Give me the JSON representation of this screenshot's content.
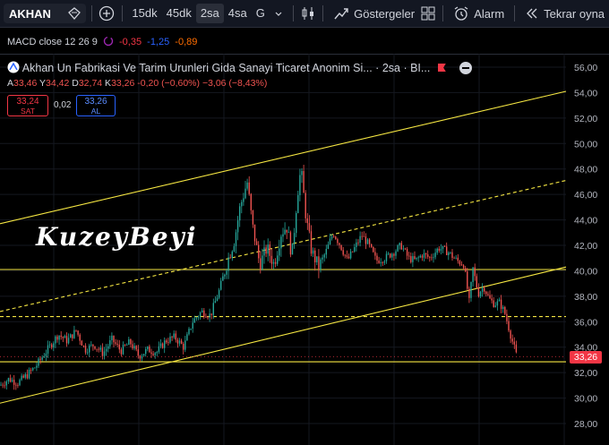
{
  "toolbar": {
    "symbol": "AKHAN",
    "intervals": [
      "15dk",
      "45dk",
      "2sa",
      "4sa",
      "G"
    ],
    "active_interval": "2sa",
    "indicators_label": "Göstergeler",
    "alarm_label": "Alarm",
    "replay_label": "Tekrar oyna"
  },
  "macd": {
    "label": "MACD close 12 26 9",
    "values": [
      "-0,35",
      "-1,25",
      "-0,89"
    ],
    "colors": [
      "#f23645",
      "#2962ff",
      "#ff6d00"
    ]
  },
  "instrument": {
    "title": "Akhan Un Fabrikasi Ve Tarim Urunleri Gida Sanayi Ticaret Anonim Si... · 2sa · BI...",
    "ohlc": {
      "a_label": "A",
      "a": "33,46",
      "y_label": "Y",
      "y": "34,42",
      "d_label": "D",
      "d": "32,74",
      "k_label": "K",
      "k": "33,26",
      "change": "-0,20 (−0,60%)",
      "change2": "−3,06 (−8,43%)"
    },
    "sell_price": "33,24",
    "sell_label": "SAT",
    "spread": "0,02",
    "buy_price": "33,26",
    "buy_label": "AL"
  },
  "watermark": "KuzeyBeyi",
  "current_price": "33,26",
  "colors": {
    "up": "#26a69a",
    "down": "#ef5350",
    "line": "#f5e642",
    "bg": "#000000"
  },
  "chart_data": {
    "type": "candlestick",
    "y_axis_ticks": [
      "56,00",
      "54,00",
      "52,00",
      "50,00",
      "48,00",
      "46,00",
      "44,00",
      "42,00",
      "40,00",
      "38,00",
      "36,00",
      "34,00",
      "32,00",
      "30,00",
      "28,00"
    ],
    "ylim": [
      26.8,
      57
    ],
    "close_path": [
      [
        0,
        31.0
      ],
      [
        10,
        31.5
      ],
      [
        20,
        31.2
      ],
      [
        30,
        31.8
      ],
      [
        40,
        32.5
      ],
      [
        55,
        34.0
      ],
      [
        65,
        35.0
      ],
      [
        75,
        34.5
      ],
      [
        85,
        35.3
      ],
      [
        95,
        33.8
      ],
      [
        105,
        34.2
      ],
      [
        115,
        33.5
      ],
      [
        125,
        34.6
      ],
      [
        135,
        33.7
      ],
      [
        145,
        34.4
      ],
      [
        155,
        33.3
      ],
      [
        165,
        33.8
      ],
      [
        175,
        33.6
      ],
      [
        185,
        34.5
      ],
      [
        195,
        34.8
      ],
      [
        205,
        34.0
      ],
      [
        215,
        36.0
      ],
      [
        225,
        36.8
      ],
      [
        235,
        36.5
      ],
      [
        245,
        38.5
      ],
      [
        255,
        41.0
      ],
      [
        262,
        42.5
      ],
      [
        268,
        45.0
      ],
      [
        276,
        47.0
      ],
      [
        282,
        43.5
      ],
      [
        290,
        40.5
      ],
      [
        298,
        41.8
      ],
      [
        306,
        40.5
      ],
      [
        314,
        43.0
      ],
      [
        320,
        43.5
      ],
      [
        326,
        41.2
      ],
      [
        332,
        46.0
      ],
      [
        336,
        48.0
      ],
      [
        342,
        44.0
      ],
      [
        348,
        41.5
      ],
      [
        356,
        40.3
      ],
      [
        364,
        41.5
      ],
      [
        372,
        43.0
      ],
      [
        380,
        42.0
      ],
      [
        388,
        40.8
      ],
      [
        396,
        41.8
      ],
      [
        404,
        42.8
      ],
      [
        412,
        42.0
      ],
      [
        420,
        40.8
      ],
      [
        430,
        41.0
      ],
      [
        440,
        41.5
      ],
      [
        448,
        42.0
      ],
      [
        456,
        41.0
      ],
      [
        464,
        40.8
      ],
      [
        472,
        41.3
      ],
      [
        480,
        41.0
      ],
      [
        490,
        41.8
      ],
      [
        500,
        41.5
      ],
      [
        510,
        40.8
      ],
      [
        518,
        40.5
      ],
      [
        524,
        37.5
      ],
      [
        528,
        40.2
      ],
      [
        534,
        38.2
      ],
      [
        540,
        38.8
      ],
      [
        546,
        37.8
      ],
      [
        552,
        37.4
      ],
      [
        558,
        37.5
      ],
      [
        564,
        36.6
      ],
      [
        570,
        35.0
      ],
      [
        574,
        34.0
      ],
      [
        577,
        33.26
      ]
    ],
    "lines": [
      {
        "name": "channel-upper",
        "from": [
          0,
          43.7
        ],
        "to": [
          632,
          54.1
        ],
        "style": "solid"
      },
      {
        "name": "channel-mid",
        "from": [
          0,
          36.8
        ],
        "to": [
          632,
          47.1
        ],
        "style": "dashed"
      },
      {
        "name": "channel-lower",
        "from": [
          0,
          29.6
        ],
        "to": [
          632,
          40.3
        ],
        "style": "solid"
      },
      {
        "name": "resistance-40",
        "from": [
          0,
          40.1
        ],
        "to": [
          632,
          40.1
        ],
        "style": "solid"
      },
      {
        "name": "level-36",
        "from": [
          0,
          36.4
        ],
        "to": [
          632,
          36.4
        ],
        "style": "dashed"
      },
      {
        "name": "support-32.8",
        "from": [
          0,
          32.85
        ],
        "to": [
          632,
          32.85
        ],
        "style": "solid"
      }
    ]
  }
}
